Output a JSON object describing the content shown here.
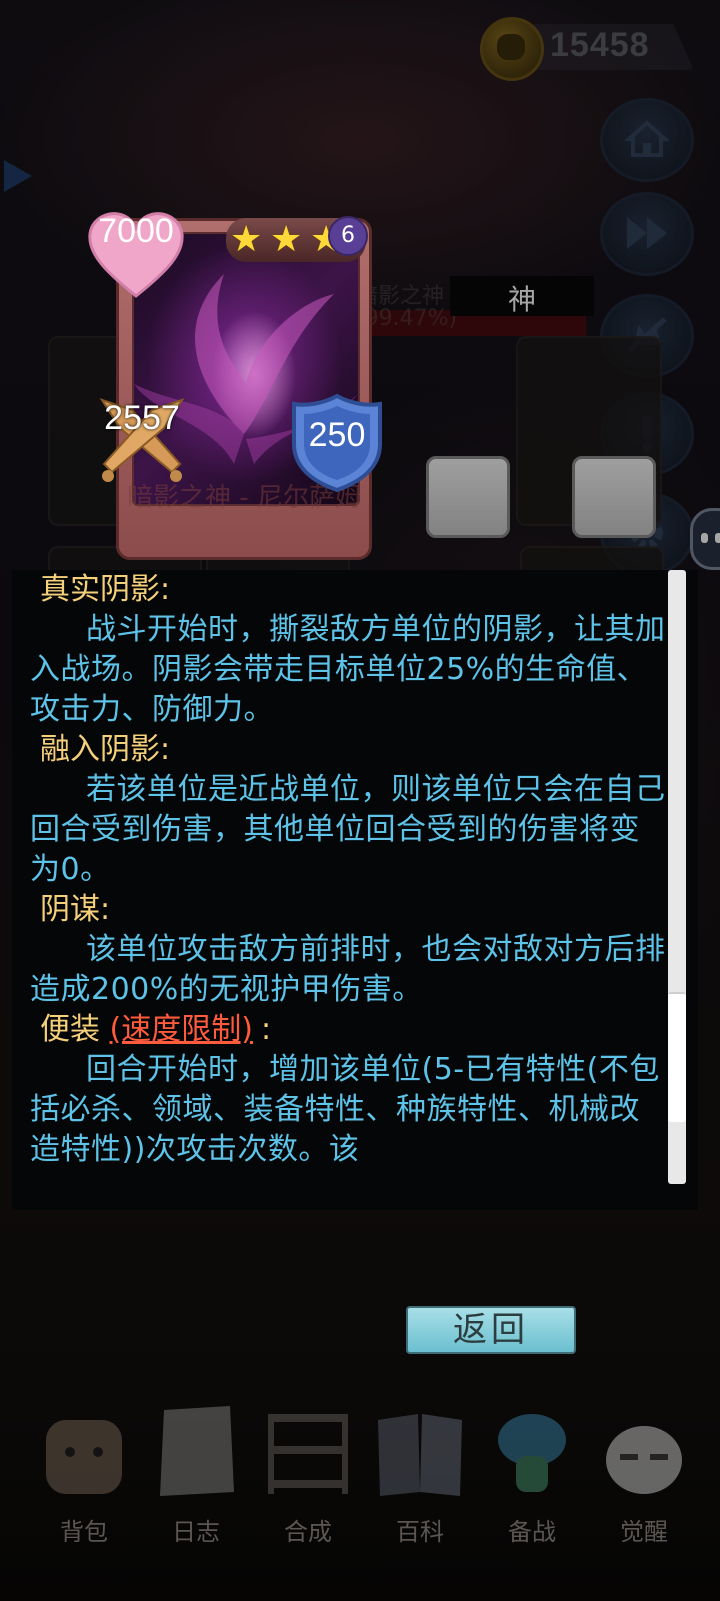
{
  "currency": {
    "coins": "15458"
  },
  "background": {
    "faded_text": [
      "暗影之神 - 尼尔萨姆",
      "(99.47%)"
    ]
  },
  "card": {
    "hp": "7000",
    "attack": "2557",
    "defense": "250",
    "star_count": 3,
    "star_level": "6",
    "name": "暗影之神 - 尼尔萨姆",
    "type_label": "神"
  },
  "description": {
    "skills": [
      {
        "title": "真实阴影:",
        "tag": "",
        "tag_suffix": "",
        "body": "战斗开始时，撕裂敌方单位的阴影，让其加入战场。阴影会带走目标单位25%的生命值、攻击力、防御力。"
      },
      {
        "title": "融入阴影:",
        "tag": "",
        "tag_suffix": "",
        "body": "若该单位是近战单位，则该单位只会在自己回合受到伤害，其他单位回合受到的伤害将变为0。"
      },
      {
        "title": "阴谋:",
        "tag": "",
        "tag_suffix": "",
        "body": "该单位攻击敌方前排时，也会对敌对方后排造成200%的无视护甲伤害。"
      },
      {
        "title": "便装",
        "tag": "(速度限制)",
        "tag_suffix": ":",
        "body": "回合开始时，增加该单位(5-已有特性(不包括必杀、领域、装备特性、种族特性、机械改造特性))次攻击次数。该"
      }
    ]
  },
  "buttons": {
    "return_label": "返回"
  },
  "nav": {
    "items": [
      {
        "label": "背包",
        "icon": "backpack-icon"
      },
      {
        "label": "日志",
        "icon": "notebook-icon"
      },
      {
        "label": "合成",
        "icon": "workbench-icon"
      },
      {
        "label": "百科",
        "icon": "book-icon"
      },
      {
        "label": "备战",
        "icon": "mushroom-icon"
      },
      {
        "label": "觉醒",
        "icon": "awaken-icon"
      }
    ]
  }
}
